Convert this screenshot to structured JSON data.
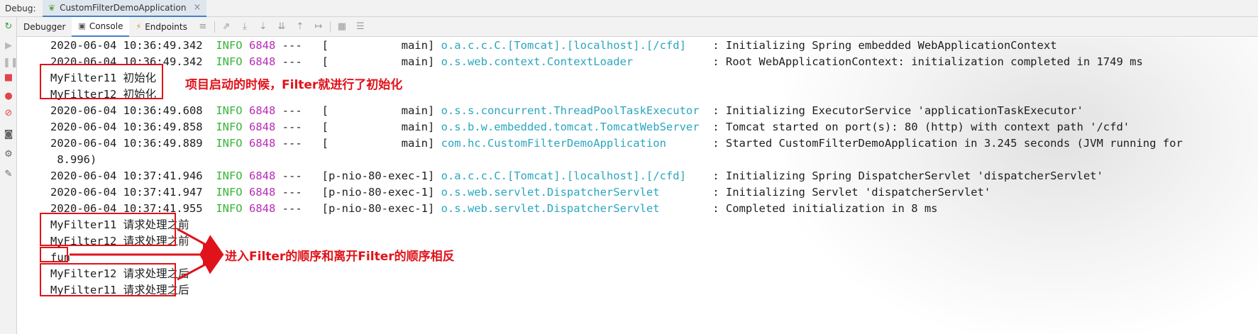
{
  "debug_bar": {
    "label": "Debug:",
    "run_config": "CustomFilterDemoApplication",
    "close_glyph": "×"
  },
  "tool_tabs": [
    {
      "label": "Debugger",
      "active": false
    },
    {
      "label": "Console",
      "active": true
    },
    {
      "label": "Endpoints",
      "active": false
    }
  ],
  "console": {
    "lines": [
      {
        "type": "log",
        "ts": "2020-06-04 10:36:49.342",
        "level": "INFO",
        "pid": "6848",
        "thread": "---   [           main] ",
        "logger": "o.a.c.c.C.[Tomcat].[localhost].[/cfd]    ",
        "msg": ": Initializing Spring embedded WebApplicationContext"
      },
      {
        "type": "log",
        "ts": "2020-06-04 10:36:49.342",
        "level": "INFO",
        "pid": "6848",
        "thread": "---   [           main] ",
        "logger": "o.s.web.context.ContextLoader            ",
        "msg": ": Root WebApplicationContext: initialization completed in 1749 ms"
      },
      {
        "type": "plain",
        "text": "MyFilter11 初始化"
      },
      {
        "type": "plain",
        "text": "MyFilter12 初始化"
      },
      {
        "type": "log",
        "ts": "2020-06-04 10:36:49.608",
        "level": "INFO",
        "pid": "6848",
        "thread": "---   [           main] ",
        "logger": "o.s.s.concurrent.ThreadPoolTaskExecutor  ",
        "msg": ": Initializing ExecutorService 'applicationTaskExecutor'"
      },
      {
        "type": "log",
        "ts": "2020-06-04 10:36:49.858",
        "level": "INFO",
        "pid": "6848",
        "thread": "---   [           main] ",
        "logger": "o.s.b.w.embedded.tomcat.TomcatWebServer  ",
        "msg": ": Tomcat started on port(s): 80 (http) with context path '/cfd'"
      },
      {
        "type": "log",
        "ts": "2020-06-04 10:36:49.889",
        "level": "INFO",
        "pid": "6848",
        "thread": "---   [           main] ",
        "logger": "com.hc.CustomFilterDemoApplication       ",
        "msg": ": Started CustomFilterDemoApplication in 3.245 seconds (JVM running for"
      },
      {
        "type": "plain",
        "text": " 8.996)"
      },
      {
        "type": "log",
        "ts": "2020-06-04 10:37:41.946",
        "level": "INFO",
        "pid": "6848",
        "thread": "---   [p-nio-80-exec-1] ",
        "logger": "o.a.c.c.C.[Tomcat].[localhost].[/cfd]    ",
        "msg": ": Initializing Spring DispatcherServlet 'dispatcherServlet'"
      },
      {
        "type": "log",
        "ts": "2020-06-04 10:37:41.947",
        "level": "INFO",
        "pid": "6848",
        "thread": "---   [p-nio-80-exec-1] ",
        "logger": "o.s.web.servlet.DispatcherServlet        ",
        "msg": ": Initializing Servlet 'dispatcherServlet'"
      },
      {
        "type": "log",
        "ts": "2020-06-04 10:37:41.955",
        "level": "INFO",
        "pid": "6848",
        "thread": "---   [p-nio-80-exec-1] ",
        "logger": "o.s.web.servlet.DispatcherServlet        ",
        "msg": ": Completed initialization in 8 ms"
      },
      {
        "type": "plain",
        "text": "MyFilter11 请求处理之前"
      },
      {
        "type": "plain",
        "text": "MyFilter12 请求处理之前"
      },
      {
        "type": "plain",
        "text": "fun"
      },
      {
        "type": "plain",
        "text": "MyFilter12 请求处理之后"
      },
      {
        "type": "plain",
        "text": "MyFilter11 请求处理之后"
      }
    ]
  },
  "annotations": {
    "init_note": "项目启动的时候，Filter就进行了初始化",
    "order_note": "进入Filter的顺序和离开Filter的顺序相反",
    "color": "#e0131a"
  },
  "colors": {
    "info": "#39b539",
    "pid": "#b72db7",
    "logger": "#2aa6bf",
    "accent": "#4083c9"
  }
}
